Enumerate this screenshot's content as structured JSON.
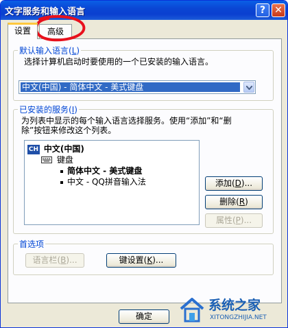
{
  "window": {
    "title": "文字服务和输入语言",
    "help_glyph": "?",
    "close_glyph": "✕"
  },
  "tabs": [
    {
      "label": "设置",
      "active": true
    },
    {
      "label": "高级",
      "active": false
    }
  ],
  "default_language": {
    "legend": "默认输入语言",
    "hotkey": "L",
    "description": "选择计算机启动时要使用的一个已安装的输入语言。",
    "selected_value": "中文(中国) - 简体中文 - 美式键盘"
  },
  "installed_services": {
    "legend": "已安装的服务",
    "hotkey": "I",
    "description_lines": [
      "为列表中显示的每个输入语言选择服务。使用“添加”和“删",
      "除”按钮来修改这个列表。"
    ],
    "language_badge": "CH",
    "language": "中文(中国)",
    "category": "键盘",
    "items": [
      {
        "label": "简体中文 - 美式键盘",
        "bold": true
      },
      {
        "label": "中文 - QQ拼音输入法",
        "bold": false
      }
    ],
    "buttons": {
      "add": {
        "text": "添加",
        "hotkey": "D",
        "suffix": "...",
        "enabled": true
      },
      "remove": {
        "text": "删除",
        "hotkey": "R",
        "suffix": "",
        "enabled": true
      },
      "properties": {
        "text": "属性",
        "hotkey": "P",
        "suffix": "...",
        "enabled": false
      }
    }
  },
  "preferences": {
    "legend": "首选项",
    "language_bar": {
      "text": "语言栏",
      "hotkey": "B",
      "suffix": "...",
      "enabled": false
    },
    "key_settings": {
      "text": "键设置",
      "hotkey": "K",
      "suffix": "...",
      "enabled": true
    }
  },
  "footer": {
    "ok_label": "确定"
  },
  "watermark": {
    "name": "系统之家",
    "url": "XITONGZHIJIA.NET"
  },
  "colors": {
    "annotation_circle": "#e8101c",
    "titlebar": "#0a46d4",
    "legend_text": "#0046d5",
    "selection": "#316ac5"
  }
}
